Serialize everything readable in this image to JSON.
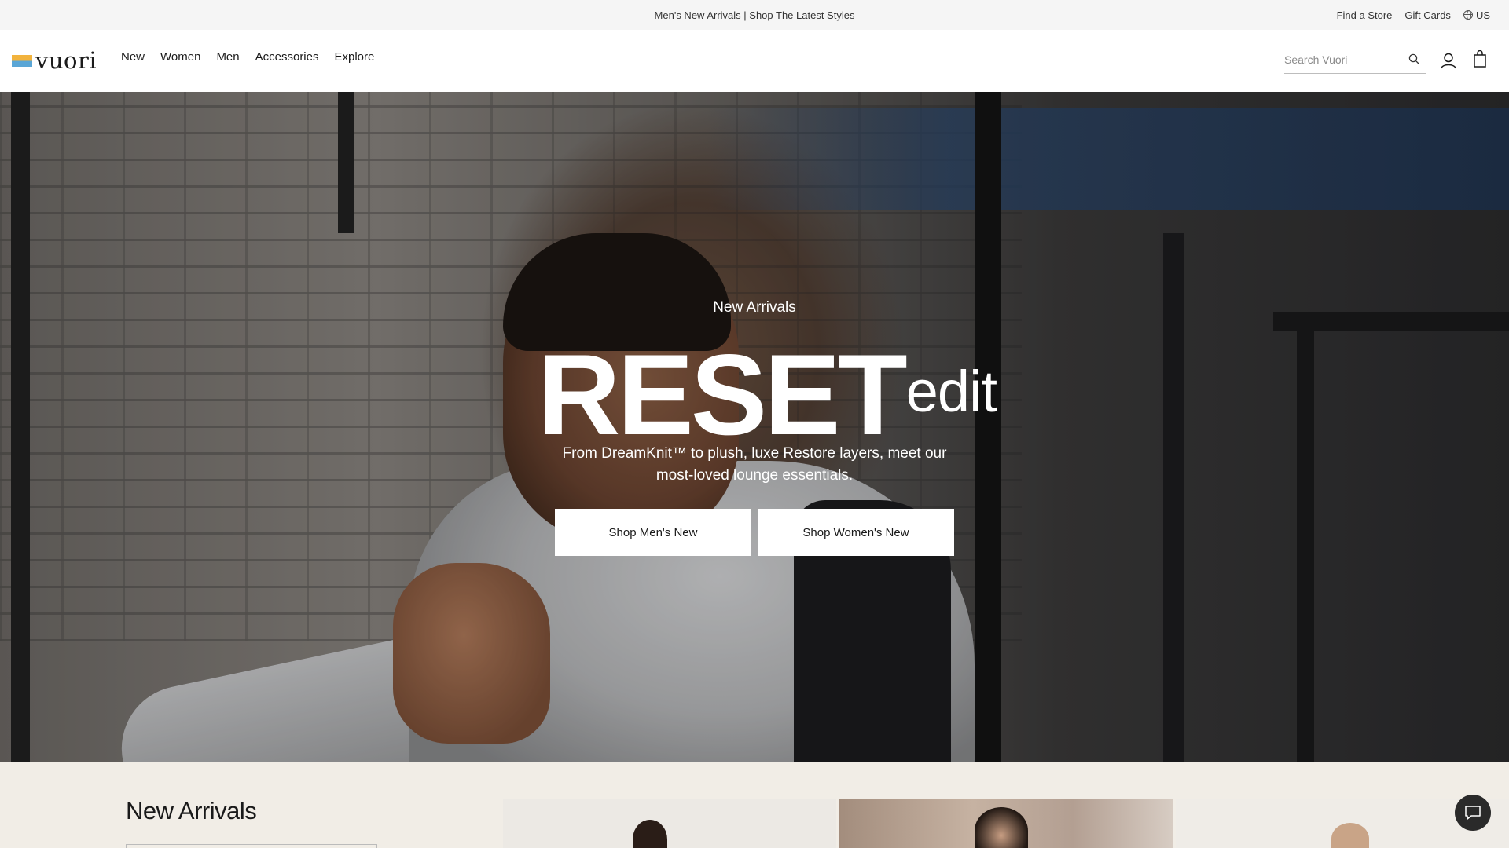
{
  "announcement": {
    "text": "Men's New Arrivals | Shop The Latest Styles",
    "find_store": "Find a Store",
    "gift_cards": "Gift Cards",
    "region": "US"
  },
  "header": {
    "logo": "vuori",
    "nav": [
      "New",
      "Women",
      "Men",
      "Accessories",
      "Explore"
    ],
    "search_placeholder": "Search Vuori"
  },
  "hero": {
    "eyebrow": "New Arrivals",
    "title_big": "RESET",
    "title_small": "edit",
    "subtitle": "From DreamKnit™ to plush, luxe Restore layers, meet our most-loved lounge essentials.",
    "buttons": [
      "Shop Men's New",
      "Shop Women's New"
    ]
  },
  "new_arrivals": {
    "title": "New Arrivals"
  },
  "colors": {
    "logo_yellow": "#f2b33d",
    "logo_blue": "#5aa6d6",
    "section_bg": "#f1ede6"
  }
}
